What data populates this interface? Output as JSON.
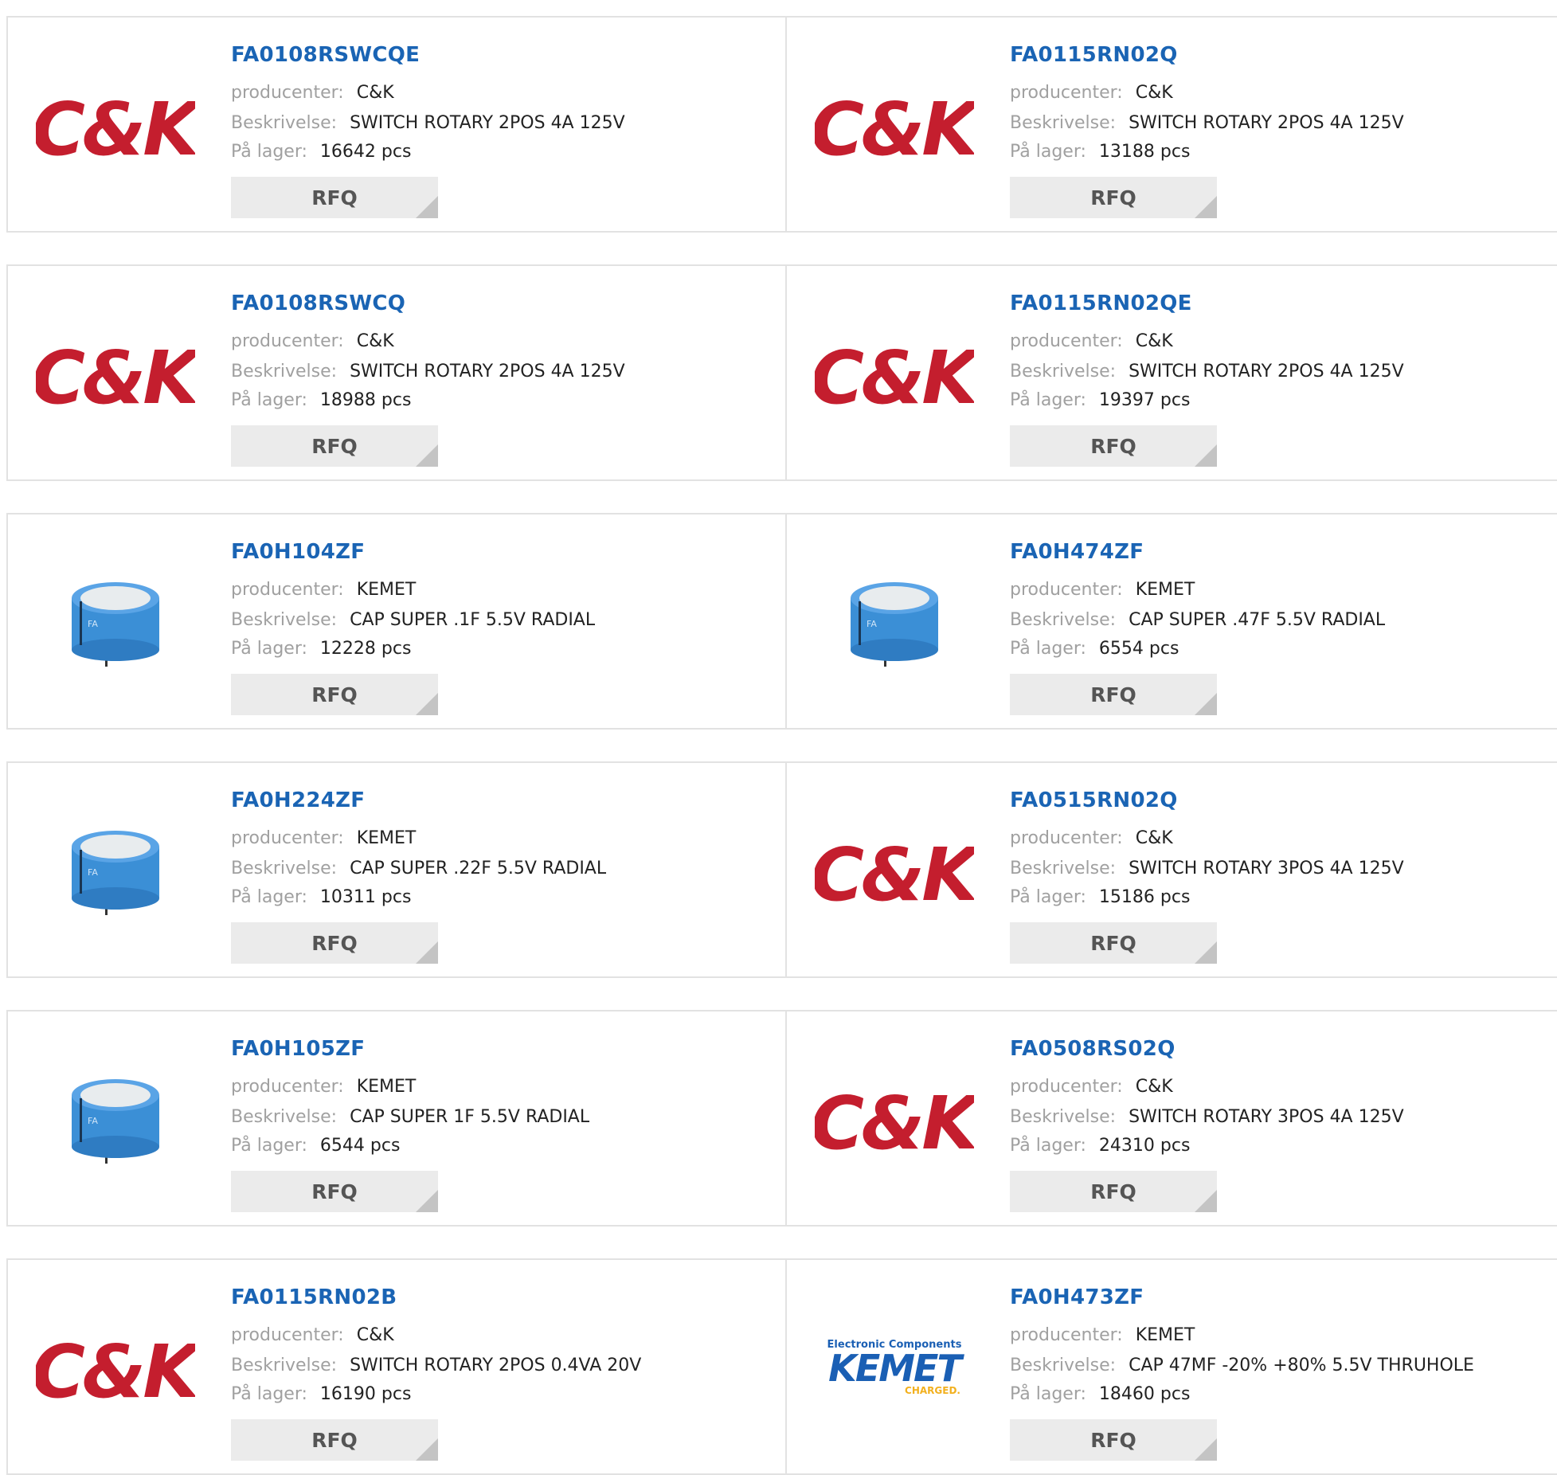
{
  "labels": {
    "manufacturer": "producenter:",
    "description": "Beskrivelse:",
    "stock": "På lager:",
    "rfq": "RFQ"
  },
  "logos": {
    "ck": "C&K",
    "kemet_top": "Electronic Components",
    "kemet_main": "KEMET",
    "kemet_bottom": "CHARGED."
  },
  "colors": {
    "link": "#1a64b4",
    "ck_red": "#c41e2e",
    "cap_blue": "#3b8fd6",
    "kemet_blue": "#1a5fb4",
    "kemet_yellow": "#f2b01e"
  },
  "products": [
    {
      "part": "FA0108RSWCQE",
      "manufacturer": "C&K",
      "description": "SWITCH ROTARY 2POS 4A 125V",
      "stock": "16642 pcs",
      "image": "ck-logo"
    },
    {
      "part": "FA0115RN02Q",
      "manufacturer": "C&K",
      "description": "SWITCH ROTARY 2POS 4A 125V",
      "stock": "13188 pcs",
      "image": "ck-logo"
    },
    {
      "part": "FA0108RSWCQ",
      "manufacturer": "C&K",
      "description": "SWITCH ROTARY 2POS 4A 125V",
      "stock": "18988 pcs",
      "image": "ck-logo"
    },
    {
      "part": "FA0115RN02QE",
      "manufacturer": "C&K",
      "description": "SWITCH ROTARY 2POS 4A 125V",
      "stock": "19397 pcs",
      "image": "ck-logo"
    },
    {
      "part": "FA0H104ZF",
      "manufacturer": "KEMET",
      "description": "CAP SUPER .1F 5.5V RADIAL",
      "stock": "12228 pcs",
      "image": "capacitor-photo"
    },
    {
      "part": "FA0H474ZF",
      "manufacturer": "KEMET",
      "description": "CAP SUPER .47F 5.5V RADIAL",
      "stock": "6554 pcs",
      "image": "capacitor-photo"
    },
    {
      "part": "FA0H224ZF",
      "manufacturer": "KEMET",
      "description": "CAP SUPER .22F 5.5V RADIAL",
      "stock": "10311 pcs",
      "image": "capacitor-photo"
    },
    {
      "part": "FA0515RN02Q",
      "manufacturer": "C&K",
      "description": "SWITCH ROTARY 3POS 4A 125V",
      "stock": "15186 pcs",
      "image": "ck-logo"
    },
    {
      "part": "FA0H105ZF",
      "manufacturer": "KEMET",
      "description": "CAP SUPER 1F 5.5V RADIAL",
      "stock": "6544 pcs",
      "image": "capacitor-photo"
    },
    {
      "part": "FA0508RS02Q",
      "manufacturer": "C&K",
      "description": "SWITCH ROTARY 3POS 4A 125V",
      "stock": "24310 pcs",
      "image": "ck-logo"
    },
    {
      "part": "FA0115RN02B",
      "manufacturer": "C&K",
      "description": "SWITCH ROTARY 2POS 0.4VA 20V",
      "stock": "16190 pcs",
      "image": "ck-logo"
    },
    {
      "part": "FA0H473ZF",
      "manufacturer": "KEMET",
      "description": "CAP 47MF -20% +80% 5.5V THRUHOLE",
      "stock": "18460 pcs",
      "image": "kemet-logo"
    }
  ]
}
